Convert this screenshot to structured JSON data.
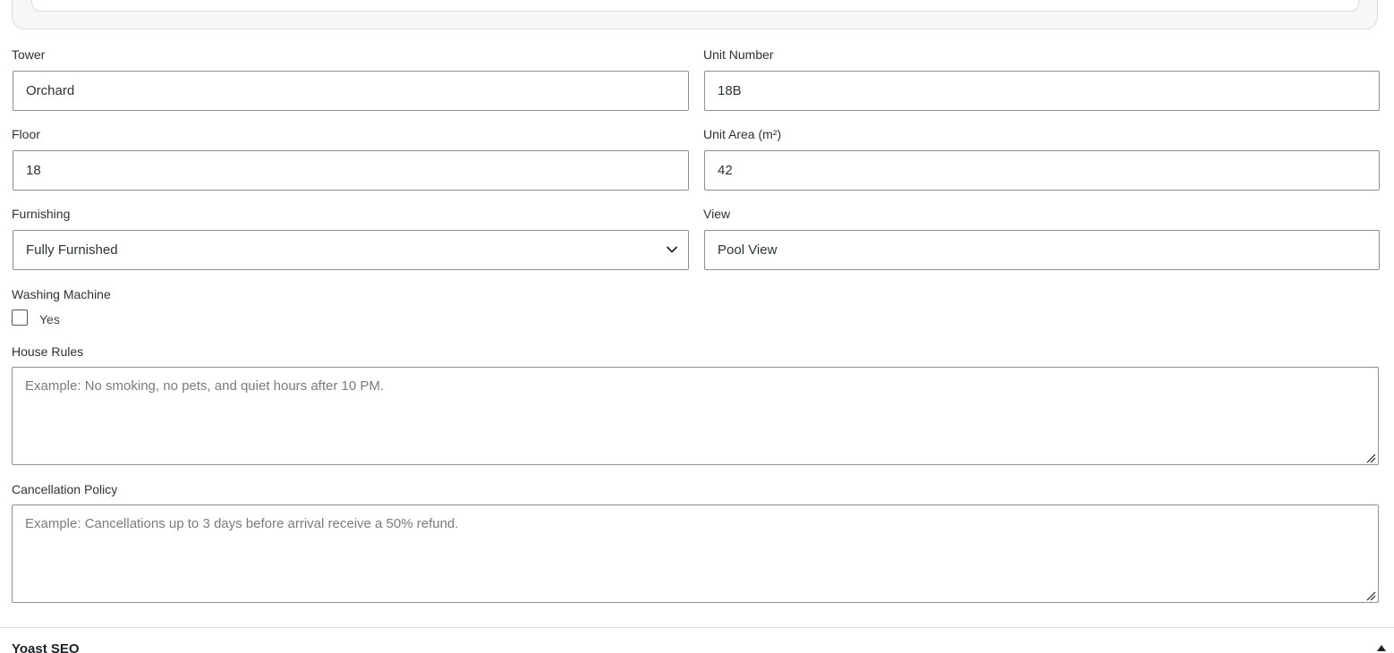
{
  "form": {
    "tower": {
      "label": "Tower",
      "value": "Orchard"
    },
    "unit_number": {
      "label": "Unit Number",
      "value": "18B"
    },
    "floor": {
      "label": "Floor",
      "value": "18"
    },
    "unit_area": {
      "label": "Unit Area (m²)",
      "value": "42"
    },
    "furnishing": {
      "label": "Furnishing",
      "value": "Fully Furnished"
    },
    "view": {
      "label": "View",
      "value": "Pool View"
    },
    "washing_machine": {
      "label": "Washing Machine",
      "option_label": "Yes",
      "checked": false
    },
    "house_rules": {
      "label": "House Rules",
      "value": "",
      "placeholder": "Example: No smoking, no pets, and quiet hours after 10 PM."
    },
    "cancellation_policy": {
      "label": "Cancellation Policy",
      "value": "",
      "placeholder": "Example: Cancellations up to 3 days before arrival receive a 50% refund."
    }
  },
  "yoast": {
    "title": "Yoast SEO"
  },
  "icons": {
    "select_arrow": "chevron-down-icon",
    "collapse": "triangle-up-icon",
    "resize": "resize-grip-icon"
  }
}
